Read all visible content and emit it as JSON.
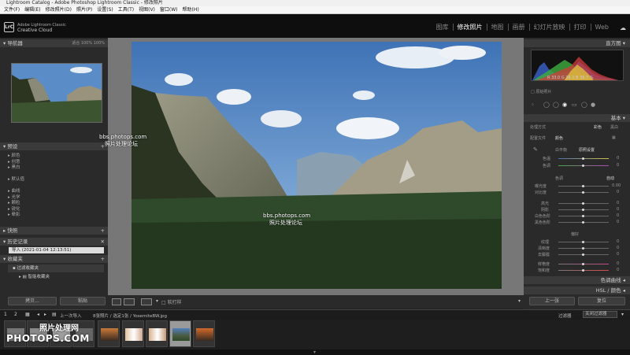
{
  "window": {
    "title": "Lightroom Catalog - Adobe Photoshop Lightroom Classic - 修改照片"
  },
  "menu": [
    "文件(F)",
    "编辑(E)",
    "修改照片(D)",
    "照片(P)",
    "设置(S)",
    "工具(T)",
    "视图(V)",
    "窗口(W)",
    "帮助(H)"
  ],
  "brand": {
    "logo": "LrC",
    "line1": "Adobe Lightroom Classic",
    "line2": "Creative Cloud"
  },
  "modules": [
    {
      "label": "图库",
      "active": false
    },
    {
      "label": "修改照片",
      "active": true
    },
    {
      "label": "地图",
      "active": false
    },
    {
      "label": "画册",
      "active": false
    },
    {
      "label": "幻灯片放映",
      "active": false
    },
    {
      "label": "打印",
      "active": false
    },
    {
      "label": "Web",
      "active": false
    }
  ],
  "left": {
    "navigator": {
      "title": "导航器",
      "zoom": [
        "适合",
        "100%",
        "100%"
      ]
    },
    "presets": {
      "title": "预设",
      "items": [
        "颜色",
        "创意",
        "黑白",
        "",
        "默认值",
        "",
        "曲线",
        "光学",
        "颗粒",
        "锐化",
        "晕影"
      ]
    },
    "snapshots": {
      "title": "快照"
    },
    "history": {
      "title": "历史记录",
      "entry": "导入 (2021-01-04 12:13:51)"
    },
    "collections": {
      "title": "收藏夹",
      "items": [
        "过滤收藏夹",
        "智能收藏夹"
      ]
    },
    "buttons": {
      "copy": "拷贝...",
      "paste": "粘贴"
    }
  },
  "watermark": {
    "site": "bbs.photops.com",
    "text": "照片处理论坛"
  },
  "toolbar": {
    "soft_proof": "软打样"
  },
  "right": {
    "histogram": {
      "title": "直方图",
      "readout": [
        "R",
        "33.0",
        "G",
        "36.1",
        "B",
        "39.7",
        "%"
      ],
      "original_label": "原始照片"
    },
    "basic": {
      "title": "基本",
      "treatment_label": "处理方式",
      "color": "彩色",
      "bw": "黑白",
      "profile_label": "配置文件",
      "profile_value": "颜色",
      "wb_label": "白平衡",
      "wb_value": "原照设置",
      "temp": "色温",
      "tint": "色调",
      "tone": "色调",
      "auto": "自动",
      "exposure": "曝光度",
      "contrast": "对比度",
      "highlights": "高光",
      "shadows": "阴影",
      "whites": "白色色阶",
      "blacks": "黑色色阶",
      "presence": "偏好",
      "texture": "纹理",
      "clarity": "清晰度",
      "dehaze": "去朦胧",
      "vibrance": "鲜艳度",
      "saturation": "饱和度"
    },
    "tone_curve": "色调曲线",
    "hsl": "HSL / 颜色",
    "prev_button": "上一张",
    "reset_button": "复位",
    "values": {
      "temp": "0",
      "tint": "0",
      "exposure": "0.00",
      "contrast": "0",
      "highlights": "0",
      "shadows": "0",
      "whites": "0",
      "blacks": "0",
      "texture": "0",
      "clarity": "0",
      "dehaze": "0",
      "vibrance": "0",
      "saturation": "0"
    }
  },
  "filmstrip": {
    "page1": "1",
    "page2": "2",
    "source": "上一次导入",
    "count": "8张照片 / 选定1张 / YosemiteBW.jpg",
    "filter_label": "过滤器",
    "filter_value": "关闭过滤器"
  },
  "site_brand": {
    "top": "照片处理网",
    "bottom": "PHOTOPS.COM"
  }
}
